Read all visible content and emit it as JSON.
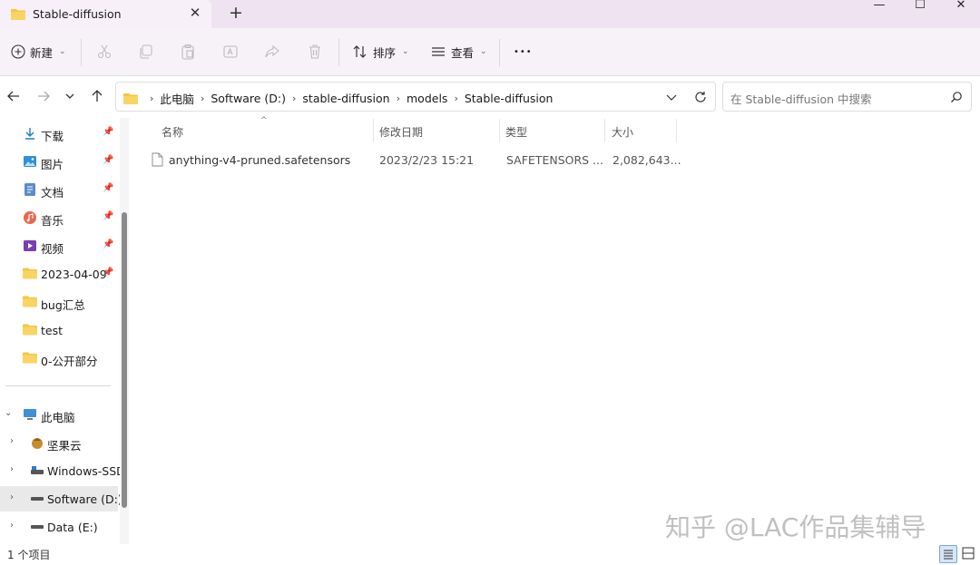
{
  "window": {
    "tab_title": "Stable-diffusion",
    "close_tab_glyph": "✕",
    "new_tab_glyph": "+",
    "controls": {
      "minimize": "—",
      "maximize": "☐",
      "close": "✕"
    }
  },
  "toolbar": {
    "new_label": "新建",
    "sort_label": "排序",
    "view_label": "查看",
    "more_glyph": "•••",
    "icons": [
      "cut-icon",
      "copy-icon",
      "paste-icon",
      "rename-icon",
      "share-icon",
      "delete-icon"
    ]
  },
  "address": {
    "crumbs": [
      "此电脑",
      "Software (D:)",
      "stable-diffusion",
      "models",
      "Stable-diffusion"
    ],
    "search_placeholder": "在 Stable-diffusion 中搜索"
  },
  "sidebar": {
    "quick_access": [
      {
        "label": "下载",
        "icon": "download-icon",
        "pinned": true
      },
      {
        "label": "图片",
        "icon": "pictures-icon",
        "pinned": true
      },
      {
        "label": "文档",
        "icon": "documents-icon",
        "pinned": true
      },
      {
        "label": "音乐",
        "icon": "music-icon",
        "pinned": true
      },
      {
        "label": "视频",
        "icon": "videos-icon",
        "pinned": true
      },
      {
        "label": "2023-04-09",
        "icon": "folder-icon",
        "pinned": true
      },
      {
        "label": "bug汇总",
        "icon": "folder-icon",
        "pinned": false
      },
      {
        "label": "test",
        "icon": "folder-icon",
        "pinned": false
      },
      {
        "label": "0-公开部分",
        "icon": "folder-icon",
        "pinned": false
      }
    ],
    "this_pc": "此电脑",
    "drives": [
      {
        "label": "坚果云",
        "icon": "jianguoyun-icon"
      },
      {
        "label": "Windows-SSD",
        "icon": "drive-icon"
      },
      {
        "label": "Software (D:)",
        "icon": "drive-icon",
        "selected": true
      },
      {
        "label": "Data (E:)",
        "icon": "drive-icon"
      }
    ]
  },
  "list": {
    "columns": [
      "名称",
      "修改日期",
      "类型",
      "大小"
    ],
    "rows": [
      {
        "name": "anything-v4-pruned.safetensors",
        "date": "2023/2/23 15:21",
        "type": "SAFETENSORS ...",
        "size": "2,082,643..."
      }
    ]
  },
  "status": {
    "count": "1 个项目"
  },
  "watermark": "知乎 @LAC作品集辅导",
  "colors": {
    "titlebar": "#efe3f2",
    "toolbar": "#f7f2f8",
    "folder": "#f4c542",
    "accent": "#0a64c8"
  }
}
